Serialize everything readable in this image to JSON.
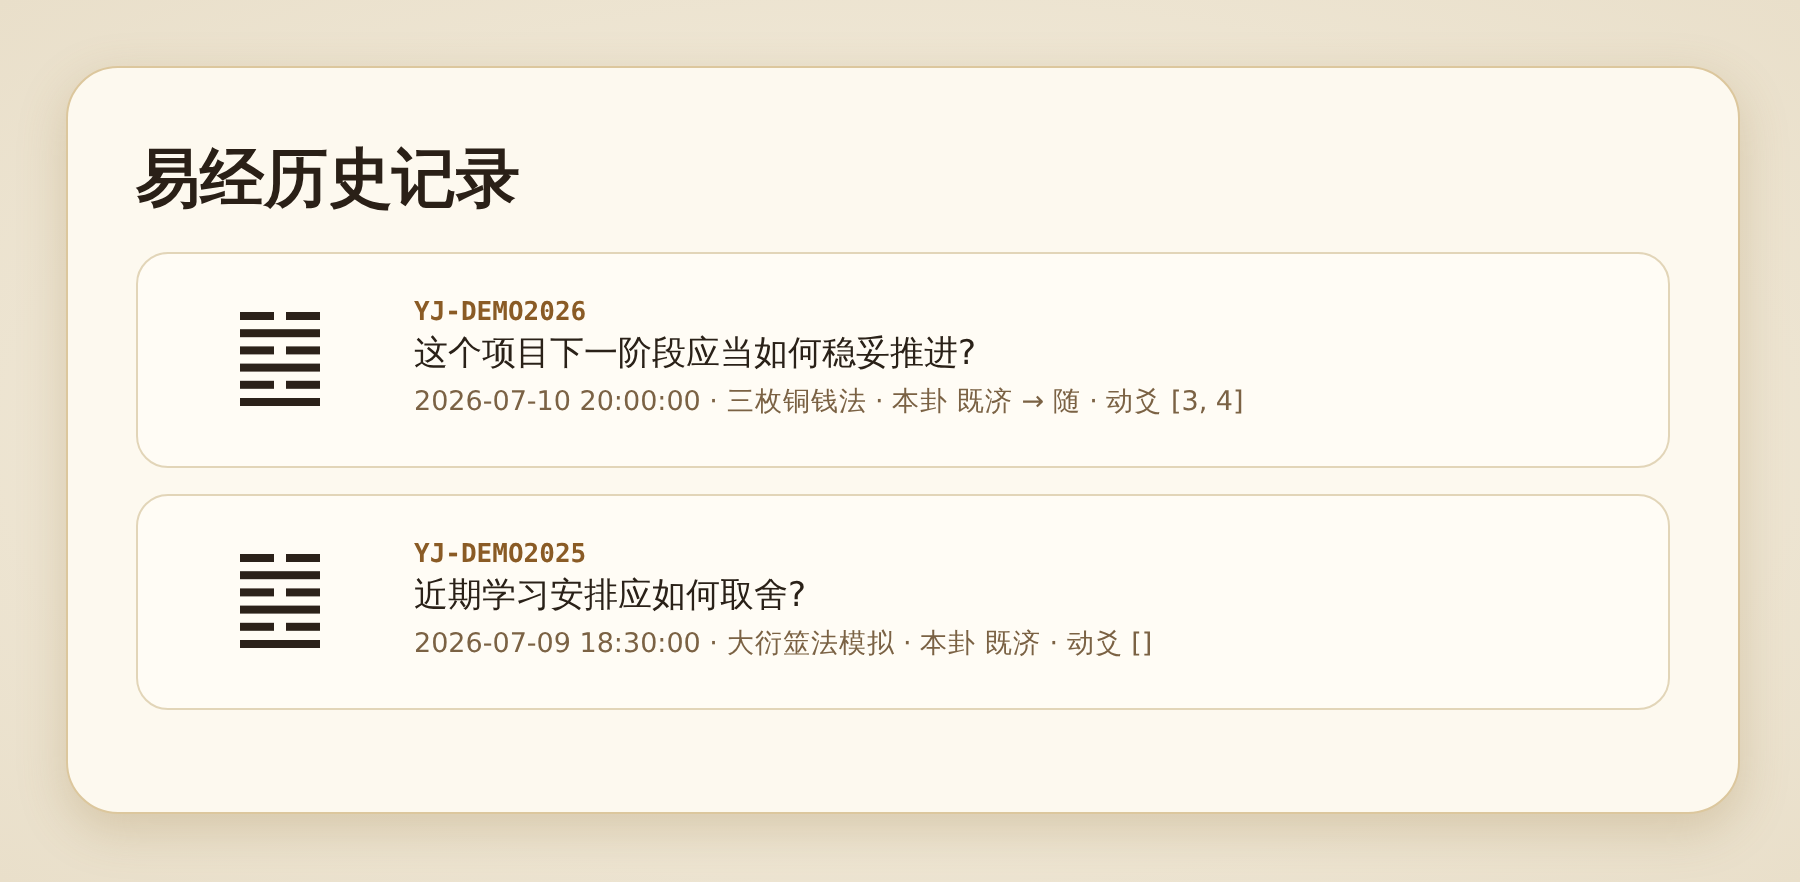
{
  "title": "易经历史记录",
  "records": [
    {
      "code": "YJ-DEMO2026",
      "question": "这个项目下一阶段应当如何稳妥推进?",
      "meta": "2026-07-10 20:00:00 · 三枚铜钱法 · 本卦 既济 → 随 · 动爻 [3, 4]",
      "lines": [
        {
          "solid": false
        },
        {
          "solid": true
        },
        {
          "solid": false
        },
        {
          "solid": true
        },
        {
          "solid": false
        },
        {
          "solid": true
        }
      ]
    },
    {
      "code": "YJ-DEMO2025",
      "question": "近期学习安排应如何取舍?",
      "meta": "2026-07-09 18:30:00 · 大衍筮法模拟 · 本卦 既济 · 动爻 []",
      "lines": [
        {
          "solid": false
        },
        {
          "solid": true
        },
        {
          "solid": false
        },
        {
          "solid": true
        },
        {
          "solid": false
        },
        {
          "solid": true
        }
      ]
    }
  ]
}
